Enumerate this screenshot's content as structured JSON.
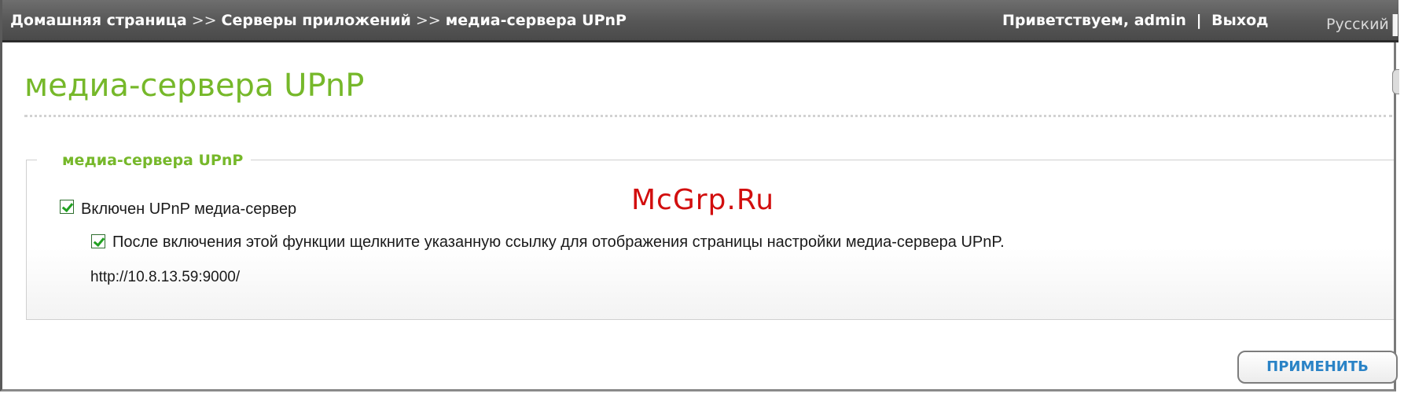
{
  "header": {
    "breadcrumb": [
      {
        "label": "Домашняя страница"
      },
      {
        "label": "Серверы приложений"
      },
      {
        "label": "медиа-сервера UPnP"
      }
    ],
    "breadcrumb_separator": ">>",
    "greeting": "Приветствуем,",
    "username": "admin",
    "pipe": "|",
    "logout_label": "Выход",
    "language": "Русский"
  },
  "page": {
    "title": "медиа-сервера UPnP"
  },
  "section": {
    "legend": "медиа-сервера UPnP",
    "enable_checkbox": {
      "label": "Включен UPnP медиа-сервер",
      "checked": true
    },
    "notice_checkbox": {
      "label": "После включения этой функции щелкните указанную ссылку для отображения страницы настройки медиа-сервера UPnP.",
      "checked": true
    },
    "link_url": "http://10.8.13.59:9000/"
  },
  "watermark": "McGrp.Ru",
  "actions": {
    "apply_label": "ПРИМЕНИТЬ"
  },
  "colors": {
    "accent_green": "#76b82a",
    "topbar_gray": "#565656",
    "button_text_blue": "#2a83c6",
    "watermark_red": "#d20e0e"
  },
  "icons": {
    "checkbox_checked": "checkmark-icon"
  }
}
